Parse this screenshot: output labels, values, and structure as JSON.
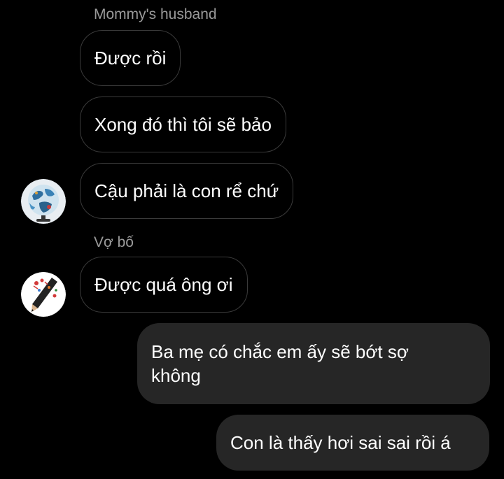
{
  "chat": {
    "messages": [
      {
        "sender_label": "Mommy's husband",
        "text": "Được rồi"
      },
      {
        "text": "Xong đó thì tôi sẽ bảo"
      },
      {
        "text": "Cậu phải là con rể chứ",
        "avatar": "globe-icon"
      },
      {
        "sender_label": "Vợ bố",
        "text": "Được quá ông ơi",
        "avatar": "pencil-art-icon"
      },
      {
        "text_line1": "Ba mẹ có chắc em ấy sẽ bớt sợ",
        "text_line2": "không",
        "outgoing": true
      },
      {
        "text": "Con là thấy hơi sai sai rồi á",
        "outgoing": true
      }
    ]
  },
  "colors": {
    "background": "#000000",
    "incoming_border": "#3a3a3a",
    "outgoing_bubble": "#262626",
    "sender_label": "#9a9a9a",
    "text": "#ffffff"
  }
}
